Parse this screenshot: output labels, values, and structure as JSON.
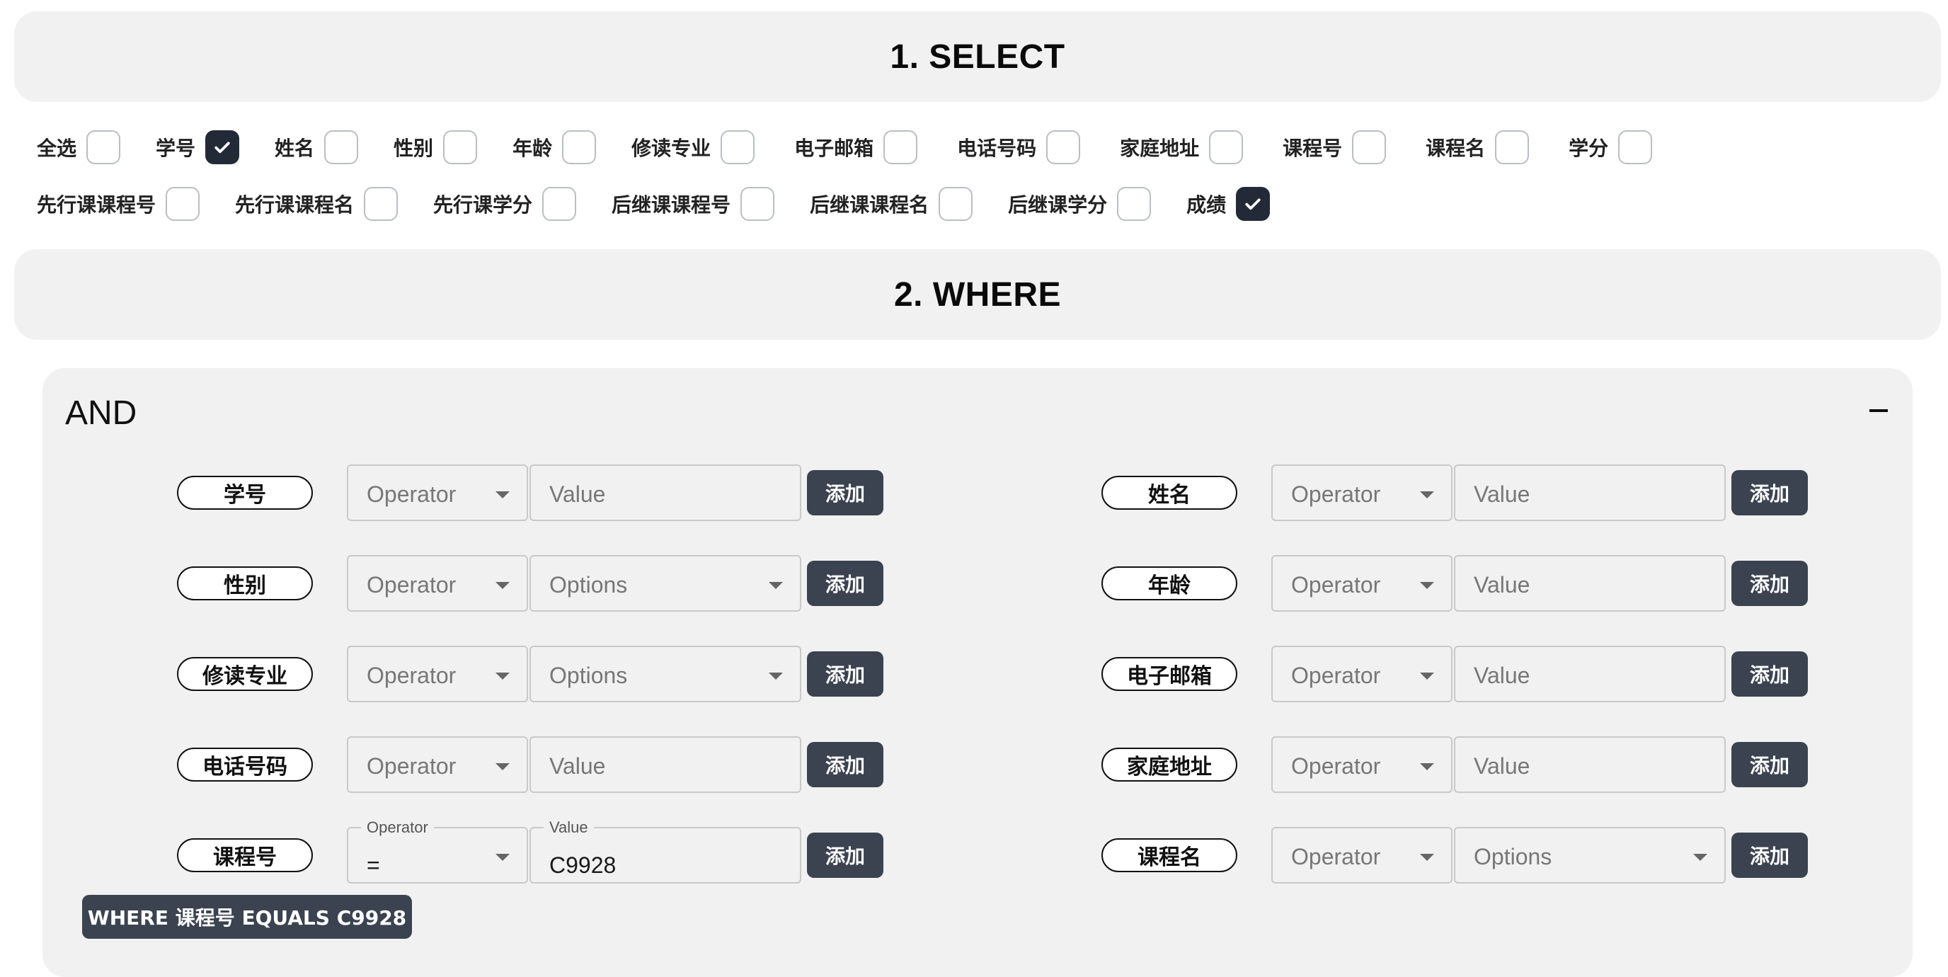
{
  "select": {
    "title": "1. SELECT",
    "fields": [
      {
        "label": "全选",
        "checked": false
      },
      {
        "label": "学号",
        "checked": true
      },
      {
        "label": "姓名",
        "checked": false
      },
      {
        "label": "性别",
        "checked": false
      },
      {
        "label": "年龄",
        "checked": false
      },
      {
        "label": "修读专业",
        "checked": false
      },
      {
        "label": "电子邮箱",
        "checked": false
      },
      {
        "label": "电话号码",
        "checked": false
      },
      {
        "label": "家庭地址",
        "checked": false
      },
      {
        "label": "课程号",
        "checked": false
      },
      {
        "label": "课程名",
        "checked": false
      },
      {
        "label": "学分",
        "checked": false
      },
      {
        "label": "先行课课程号",
        "checked": false
      },
      {
        "label": "先行课课程名",
        "checked": false
      },
      {
        "label": "先行课学分",
        "checked": false
      },
      {
        "label": "后继课课程号",
        "checked": false
      },
      {
        "label": "后继课课程名",
        "checked": false
      },
      {
        "label": "后继课学分",
        "checked": false
      },
      {
        "label": "成绩",
        "checked": true
      }
    ]
  },
  "where": {
    "title": "2. WHERE",
    "logic": "AND",
    "collapse_label": "−",
    "conditions": [
      {
        "field": "学号",
        "operator_placeholder": "Operator",
        "value_placeholder": "Value",
        "add_label": "添加"
      },
      {
        "field": "姓名",
        "operator_placeholder": "Operator",
        "value_placeholder": "Value",
        "add_label": "添加"
      },
      {
        "field": "性别",
        "operator_placeholder": "Operator",
        "value_placeholder": "Options",
        "add_label": "添加"
      },
      {
        "field": "年龄",
        "operator_placeholder": "Operator",
        "value_placeholder": "Value",
        "add_label": "添加"
      },
      {
        "field": "修读专业",
        "operator_placeholder": "Operator",
        "value_placeholder": "Options",
        "add_label": "添加"
      },
      {
        "field": "电子邮箱",
        "operator_placeholder": "Operator",
        "value_placeholder": "Value",
        "add_label": "添加"
      },
      {
        "field": "电话号码",
        "operator_placeholder": "Operator",
        "value_placeholder": "Value",
        "add_label": "添加"
      },
      {
        "field": "家庭地址",
        "operator_placeholder": "Operator",
        "value_placeholder": "Value",
        "add_label": "添加"
      },
      {
        "field": "课程号",
        "operator_label": "Operator",
        "operator_value": "=",
        "value_label": "Value",
        "value": "C9928",
        "add_label": "添加"
      },
      {
        "field": "课程名",
        "operator_placeholder": "Operator",
        "value_placeholder": "Options",
        "add_label": "添加"
      }
    ],
    "summary": "WHERE 课程号 EQUALS C9928"
  },
  "colors": {
    "panel_bg": "#f1f1f1",
    "checked_bg": "#232a37",
    "button_bg": "#3b4250"
  }
}
